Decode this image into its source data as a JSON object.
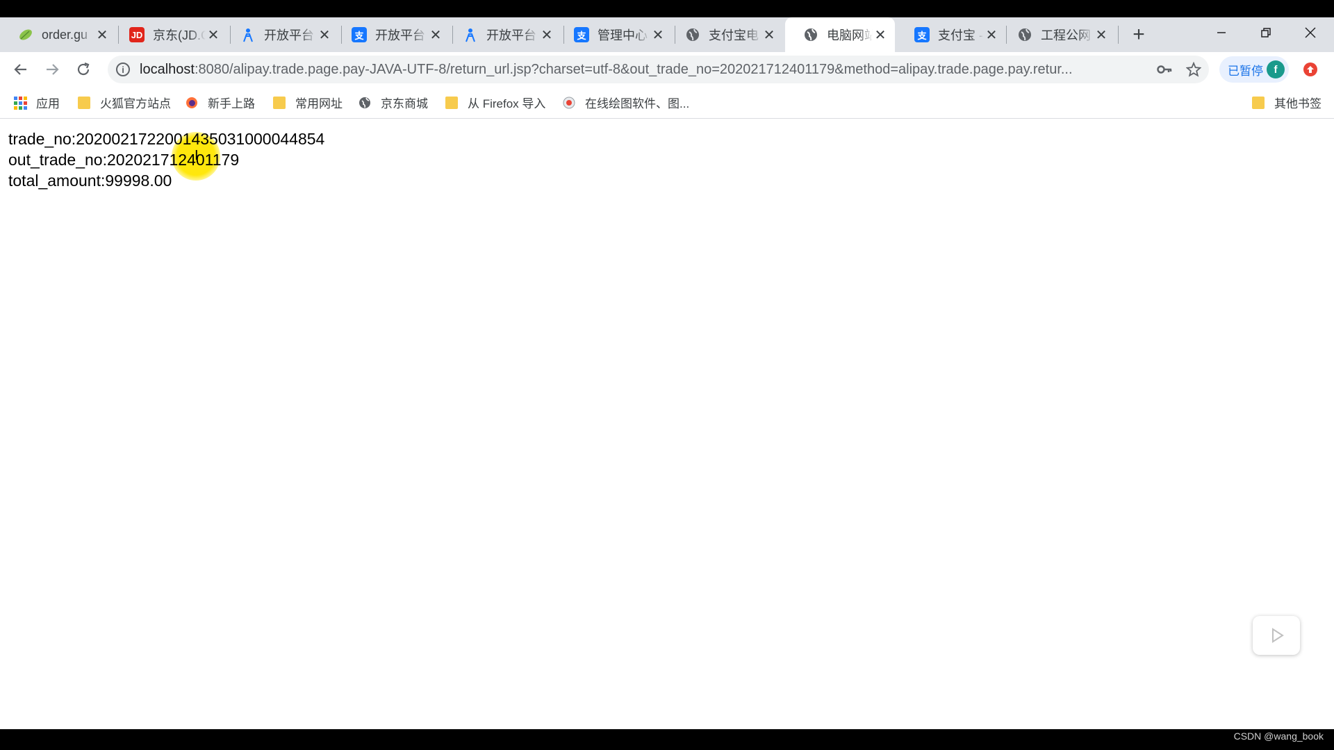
{
  "browser": {
    "tabs": [
      {
        "title": "order.gu",
        "icon": "leaf-icon"
      },
      {
        "title": "京东(JD.C",
        "icon": "jd-icon"
      },
      {
        "title": "开放平台",
        "icon": "developer-icon"
      },
      {
        "title": "开放平台",
        "icon": "alipay-icon"
      },
      {
        "title": "开放平台",
        "icon": "developer-icon"
      },
      {
        "title": "管理中心",
        "icon": "alipay-icon"
      },
      {
        "title": "支付宝电",
        "icon": "globe-icon"
      },
      {
        "title": "电脑网站",
        "icon": "globe-icon",
        "active": true
      },
      {
        "title": "支付宝 -",
        "icon": "alipay-icon"
      },
      {
        "title": "工程公网",
        "icon": "globe-icon"
      }
    ],
    "tab_close_glyph": "✕",
    "new_tab_glyph": "+",
    "url_host": "localhost",
    "url_rest": ":8080/alipay.trade.page.pay-JAVA-UTF-8/return_url.jsp?charset=utf-8&out_trade_no=202021712401179&method=alipay.trade.page.pay.retur...",
    "sync_status": "已暂停",
    "avatar_letter": "f",
    "bookmarks": [
      {
        "label": "应用",
        "icon": "apps-icon"
      },
      {
        "label": "火狐官方站点",
        "icon": "folder-icon"
      },
      {
        "label": "新手上路",
        "icon": "firefox-icon"
      },
      {
        "label": "常用网址",
        "icon": "folder-icon"
      },
      {
        "label": "京东商城",
        "icon": "globe-icon"
      },
      {
        "label": "从 Firefox 导入",
        "icon": "folder-icon"
      },
      {
        "label": "在线绘图软件、图...",
        "icon": "drawio-icon"
      }
    ],
    "other_bookmarks": "其他书签"
  },
  "page": {
    "lines": [
      "trade_no:2020021722001435031000044854",
      "out_trade_no:202021712401179",
      "total_amount:99998.00"
    ]
  },
  "watermark": "CSDN @wang_book",
  "colors": {
    "alipay": "#1677ff",
    "jd": "#e1251b",
    "highlight": "#ffe600"
  }
}
